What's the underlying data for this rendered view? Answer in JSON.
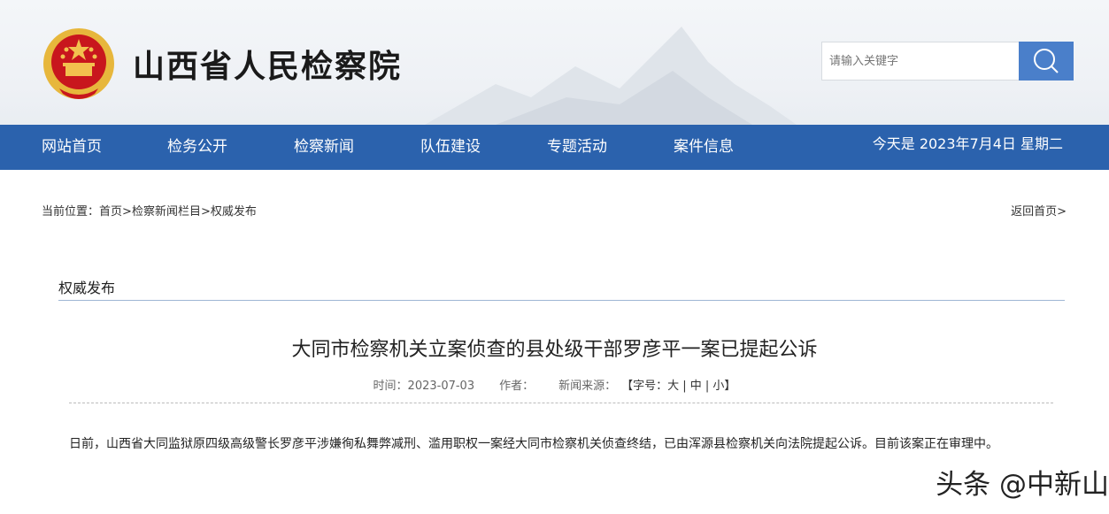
{
  "site": {
    "title": "山西省人民检察院"
  },
  "search": {
    "placeholder": "请输入关键字"
  },
  "nav": {
    "items": [
      "网站首页",
      "检务公开",
      "检察新闻",
      "队伍建设",
      "专题活动",
      "案件信息"
    ],
    "date": "今天是 2023年7月4日 星期二"
  },
  "breadcrumb": {
    "prefix": "当前位置：",
    "home": "首页",
    "sep": ">",
    "column": "检察新闻栏目",
    "current": "权威发布",
    "back": "返回首页>"
  },
  "section": {
    "title": "权威发布"
  },
  "article": {
    "title": "大同市检察机关立案侦查的县处级干部罗彦平一案已提起公诉",
    "time": "时间：2023-07-03",
    "author": "作者：",
    "source": "新闻来源：",
    "font_size_label": "【字号：大 | 中 | 小】",
    "body": "日前，山西省大同监狱原四级高级警长罗彦平涉嫌徇私舞弊减刑、滥用职权一案经大同市检察机关侦查终结，已由浑源县检察机关向法院提起公诉。目前该案正在审理中。"
  },
  "watermark": "头条 @中新山",
  "colors": {
    "nav_bg": "#2b62ad",
    "search_btn": "#4a7fca",
    "emblem_red": "#c8161d",
    "emblem_gold": "#f2c14e"
  },
  "icons": {
    "search": "search-icon",
    "emblem": "national-emblem-icon"
  }
}
